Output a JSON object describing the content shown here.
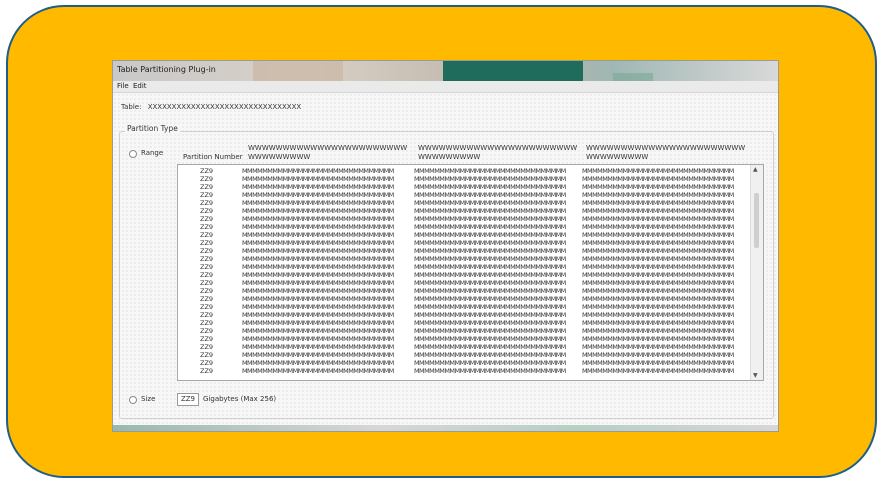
{
  "window": {
    "title": "Table Partitioning Plug-in"
  },
  "menu": {
    "file": "File",
    "edit": "Edit"
  },
  "table": {
    "label": "Table:",
    "value": "XXXXXXXXXXXXXXXXXXXXXXXXXXXXXXXX"
  },
  "partition_type": {
    "legend": "Partition Type",
    "range_label": "Range",
    "size_label": "Size",
    "size_value": "ZZ9",
    "size_suffix": "Gigabytes (Max 256)"
  },
  "list": {
    "headers": {
      "number": "Partition Number",
      "col1": "WWWWWWWWWWWWWWWWWWWWWWWWWWWWWWWW",
      "col2": "WWWWWWWWWWWWWWWWWWWWWWWWWWWWWWWW",
      "col3": "WWWWWWWWWWWWWWWWWWWWWWWWWWWWWWWW"
    },
    "rows": [
      {
        "num": "ZZ9",
        "c1": "MMMMMMMMMMMMMMMMMMMMMMMMMMMMMM",
        "c2": "MMMMMMMMMMMMMMMMMMMMMMMMMMMMMM",
        "c3": "MMMMMMMMMMMMMMMMMMMMMMMMMMMMMM"
      },
      {
        "num": "ZZ9",
        "c1": "MMMMMMMMMMMMMMMMMMMMMMMMMMMMMM",
        "c2": "MMMMMMMMMMMMMMMMMMMMMMMMMMMMMM",
        "c3": "MMMMMMMMMMMMMMMMMMMMMMMMMMMMMM"
      },
      {
        "num": "ZZ9",
        "c1": "MMMMMMMMMMMMMMMMMMMMMMMMMMMMMM",
        "c2": "MMMMMMMMMMMMMMMMMMMMMMMMMMMMMM",
        "c3": "MMMMMMMMMMMMMMMMMMMMMMMMMMMMMM"
      },
      {
        "num": "ZZ9",
        "c1": "MMMMMMMMMMMMMMMMMMMMMMMMMMMMMM",
        "c2": "MMMMMMMMMMMMMMMMMMMMMMMMMMMMMM",
        "c3": "MMMMMMMMMMMMMMMMMMMMMMMMMMMMMM"
      },
      {
        "num": "ZZ9",
        "c1": "MMMMMMMMMMMMMMMMMMMMMMMMMMMMMM",
        "c2": "MMMMMMMMMMMMMMMMMMMMMMMMMMMMMM",
        "c3": "MMMMMMMMMMMMMMMMMMMMMMMMMMMMMM"
      },
      {
        "num": "ZZ9",
        "c1": "MMMMMMMMMMMMMMMMMMMMMMMMMMMMMM",
        "c2": "MMMMMMMMMMMMMMMMMMMMMMMMMMMMMM",
        "c3": "MMMMMMMMMMMMMMMMMMMMMMMMMMMMMM"
      },
      {
        "num": "ZZ9",
        "c1": "MMMMMMMMMMMMMMMMMMMMMMMMMMMMMM",
        "c2": "MMMMMMMMMMMMMMMMMMMMMMMMMMMMMM",
        "c3": "MMMMMMMMMMMMMMMMMMMMMMMMMMMMMM"
      },
      {
        "num": "ZZ9",
        "c1": "MMMMMMMMMMMMMMMMMMMMMMMMMMMMMM",
        "c2": "MMMMMMMMMMMMMMMMMMMMMMMMMMMMMM",
        "c3": "MMMMMMMMMMMMMMMMMMMMMMMMMMMMMM"
      },
      {
        "num": "ZZ9",
        "c1": "MMMMMMMMMMMMMMMMMMMMMMMMMMMMMM",
        "c2": "MMMMMMMMMMMMMMMMMMMMMMMMMMMMMM",
        "c3": "MMMMMMMMMMMMMMMMMMMMMMMMMMMMMM"
      },
      {
        "num": "ZZ9",
        "c1": "MMMMMMMMMMMMMMMMMMMMMMMMMMMMMM",
        "c2": "MMMMMMMMMMMMMMMMMMMMMMMMMMMMMM",
        "c3": "MMMMMMMMMMMMMMMMMMMMMMMMMMMMMM"
      },
      {
        "num": "ZZ9",
        "c1": "MMMMMMMMMMMMMMMMMMMMMMMMMMMMMM",
        "c2": "MMMMMMMMMMMMMMMMMMMMMMMMMMMMMM",
        "c3": "MMMMMMMMMMMMMMMMMMMMMMMMMMMMMM"
      },
      {
        "num": "ZZ9",
        "c1": "MMMMMMMMMMMMMMMMMMMMMMMMMMMMMM",
        "c2": "MMMMMMMMMMMMMMMMMMMMMMMMMMMMMM",
        "c3": "MMMMMMMMMMMMMMMMMMMMMMMMMMMMMM"
      },
      {
        "num": "ZZ9",
        "c1": "MMMMMMMMMMMMMMMMMMMMMMMMMMMMMM",
        "c2": "MMMMMMMMMMMMMMMMMMMMMMMMMMMMMM",
        "c3": "MMMMMMMMMMMMMMMMMMMMMMMMMMMMMM"
      },
      {
        "num": "ZZ9",
        "c1": "MMMMMMMMMMMMMMMMMMMMMMMMMMMMMM",
        "c2": "MMMMMMMMMMMMMMMMMMMMMMMMMMMMMM",
        "c3": "MMMMMMMMMMMMMMMMMMMMMMMMMMMMMM"
      },
      {
        "num": "ZZ9",
        "c1": "MMMMMMMMMMMMMMMMMMMMMMMMMMMMMM",
        "c2": "MMMMMMMMMMMMMMMMMMMMMMMMMMMMMM",
        "c3": "MMMMMMMMMMMMMMMMMMMMMMMMMMMMMM"
      },
      {
        "num": "ZZ9",
        "c1": "MMMMMMMMMMMMMMMMMMMMMMMMMMMMMM",
        "c2": "MMMMMMMMMMMMMMMMMMMMMMMMMMMMMM",
        "c3": "MMMMMMMMMMMMMMMMMMMMMMMMMMMMMM"
      },
      {
        "num": "ZZ9",
        "c1": "MMMMMMMMMMMMMMMMMMMMMMMMMMMMMM",
        "c2": "MMMMMMMMMMMMMMMMMMMMMMMMMMMMMM",
        "c3": "MMMMMMMMMMMMMMMMMMMMMMMMMMMMMM"
      },
      {
        "num": "ZZ9",
        "c1": "MMMMMMMMMMMMMMMMMMMMMMMMMMMMMM",
        "c2": "MMMMMMMMMMMMMMMMMMMMMMMMMMMMMM",
        "c3": "MMMMMMMMMMMMMMMMMMMMMMMMMMMMMM"
      },
      {
        "num": "ZZ9",
        "c1": "MMMMMMMMMMMMMMMMMMMMMMMMMMMMMM",
        "c2": "MMMMMMMMMMMMMMMMMMMMMMMMMMMMMM",
        "c3": "MMMMMMMMMMMMMMMMMMMMMMMMMMMMMM"
      },
      {
        "num": "ZZ9",
        "c1": "MMMMMMMMMMMMMMMMMMMMMMMMMMMMMM",
        "c2": "MMMMMMMMMMMMMMMMMMMMMMMMMMMMMM",
        "c3": "MMMMMMMMMMMMMMMMMMMMMMMMMMMMMM"
      },
      {
        "num": "ZZ9",
        "c1": "MMMMMMMMMMMMMMMMMMMMMMMMMMMMMM",
        "c2": "MMMMMMMMMMMMMMMMMMMMMMMMMMMMMM",
        "c3": "MMMMMMMMMMMMMMMMMMMMMMMMMMMMMM"
      },
      {
        "num": "ZZ9",
        "c1": "MMMMMMMMMMMMMMMMMMMMMMMMMMMMMM",
        "c2": "MMMMMMMMMMMMMMMMMMMMMMMMMMMMMM",
        "c3": "MMMMMMMMMMMMMMMMMMMMMMMMMMMMMM"
      },
      {
        "num": "ZZ9",
        "c1": "MMMMMMMMMMMMMMMMMMMMMMMMMMMMMM",
        "c2": "MMMMMMMMMMMMMMMMMMMMMMMMMMMMMM",
        "c3": "MMMMMMMMMMMMMMMMMMMMMMMMMMMMMM"
      },
      {
        "num": "ZZ9",
        "c1": "MMMMMMMMMMMMMMMMMMMMMMMMMMMMMM",
        "c2": "MMMMMMMMMMMMMMMMMMMMMMMMMMMMMM",
        "c3": "MMMMMMMMMMMMMMMMMMMMMMMMMMMMMM"
      },
      {
        "num": "ZZ9",
        "c1": "MMMMMMMMMMMMMMMMMMMMMMMMMMMMMM",
        "c2": "MMMMMMMMMMMMMMMMMMMMMMMMMMMMMM",
        "c3": "MMMMMMMMMMMMMMMMMMMMMMMMMMMMMM"
      },
      {
        "num": "ZZ9",
        "c1": "MMMMMMMMMMMMMMMMMMMMMMMMMMMMMM",
        "c2": "MMMMMMMMMMMMMMMMMMMMMMMMMMMMMM",
        "c3": "MMMMMMMMMMMMMMMMMMMMMMMMMMMMMM"
      }
    ]
  },
  "colors": {
    "frame": "#ffba00",
    "frame_border": "#1d5e8a"
  }
}
